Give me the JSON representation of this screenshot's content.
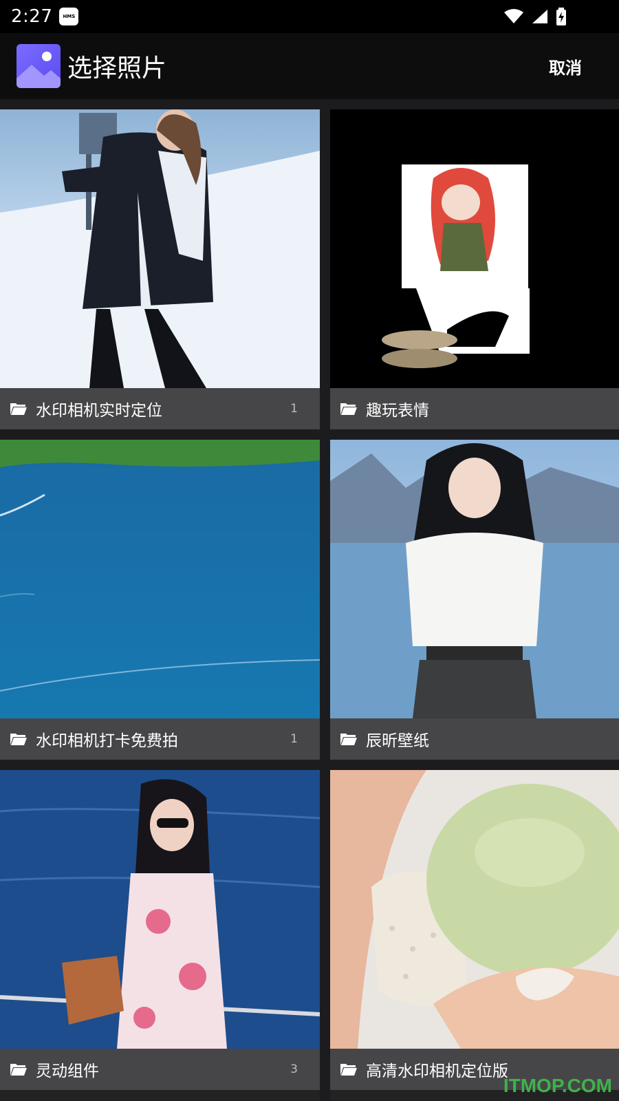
{
  "status_bar": {
    "time": "2:27",
    "badge": "HMS",
    "icons": [
      "wifi-icon",
      "signal-icon",
      "battery-charging-icon"
    ]
  },
  "app_bar": {
    "title": "选择照片",
    "cancel_label": "取消",
    "logo_icon": "gallery-logo-icon"
  },
  "albums": [
    {
      "name": "水印相机实时定位",
      "count": "1"
    },
    {
      "name": "趣玩表情",
      "count": ""
    },
    {
      "name": "水印相机打卡免费拍",
      "count": "1"
    },
    {
      "name": "辰昕壁纸",
      "count": ""
    },
    {
      "name": "灵动组件",
      "count": "3"
    },
    {
      "name": "高清水印相机定位版",
      "count": ""
    }
  ],
  "watermark": "ITMOP.COM"
}
